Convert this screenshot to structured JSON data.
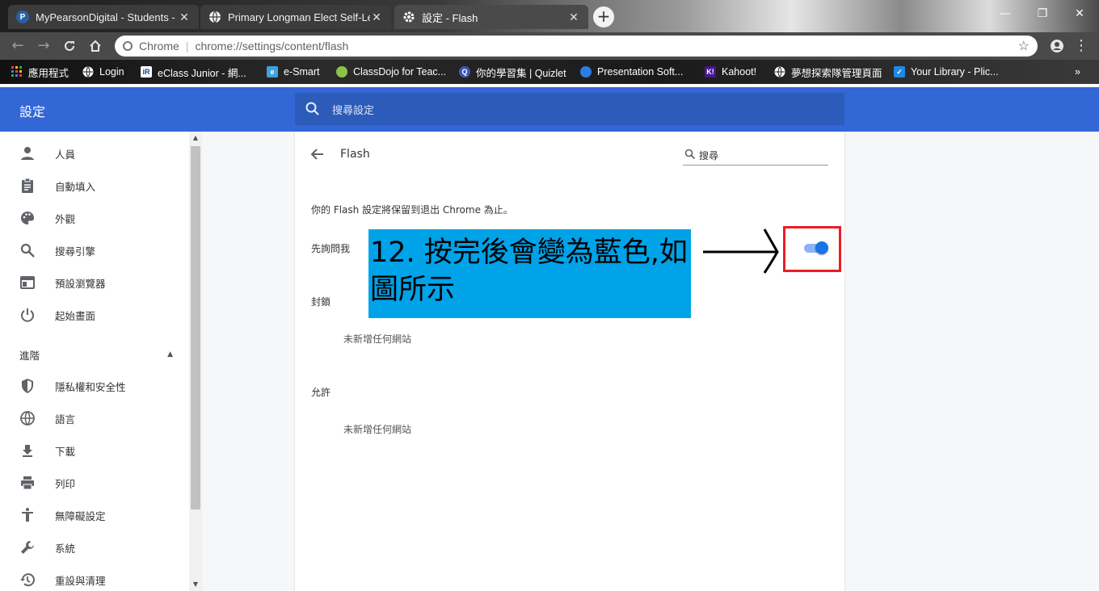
{
  "browser": {
    "tabs": [
      {
        "title": "MyPearsonDigital - Students - ",
        "favicon_color": "#2b5ea8",
        "favicon": "P",
        "active": false
      },
      {
        "title": "Primary Longman Elect Self-Lea",
        "favicon_color": "#5f6368",
        "favicon": "globe-icon",
        "active": false
      },
      {
        "title": "設定 - Flash",
        "favicon_color": "#5f6368",
        "favicon": "gear-icon",
        "active": true
      }
    ],
    "new_tab_label": "+",
    "window_controls": {
      "minimize": "—",
      "restore": "❐",
      "close": "✕"
    },
    "address": {
      "origin": "Chrome",
      "separator": "|",
      "url": "chrome://settings/content/flash"
    },
    "bookmarks": [
      {
        "label": "應用程式",
        "icon": "apps-grid-icon",
        "color": "#e8453c"
      },
      {
        "label": "Login",
        "icon": "globe-icon",
        "color": "#ffffff"
      },
      {
        "label": "eClass Junior - 網...",
        "icon": "eclass-icon",
        "color": "#ffffff"
      },
      {
        "label": "e-Smart",
        "icon": "esmart-icon",
        "color": "#3ea3dc"
      },
      {
        "label": "ClassDojo for Teac...",
        "icon": "classdojo-icon",
        "color": "#8bc34a"
      },
      {
        "label": "你的學習集 | Quizlet",
        "icon": "quizlet-icon",
        "color": "#4257b2"
      },
      {
        "label": "Presentation Soft...",
        "icon": "presentation-icon",
        "color": "#2d7de0"
      },
      {
        "label": "Kahoot!",
        "icon": "kahoot-icon",
        "color": "#46178f"
      },
      {
        "label": "夢想探索隊管理頁面",
        "icon": "globe-icon",
        "color": "#ffffff"
      },
      {
        "label": "Your Library - Plic...",
        "icon": "checkbox-icon",
        "color": "#1e88e5"
      }
    ],
    "more_bookmarks": "»"
  },
  "settings": {
    "title": "設定",
    "search_placeholder": "搜尋設定",
    "sidebar": {
      "items": [
        {
          "label": "人員",
          "icon": "person-icon"
        },
        {
          "label": "自動填入",
          "icon": "clipboard-icon"
        },
        {
          "label": "外觀",
          "icon": "palette-icon"
        },
        {
          "label": "搜尋引擎",
          "icon": "search-icon"
        },
        {
          "label": "預設瀏覽器",
          "icon": "browser-icon"
        },
        {
          "label": "起始畫面",
          "icon": "power-icon"
        }
      ],
      "advanced_label": "進階",
      "advanced_items": [
        {
          "label": "隱私權和安全性",
          "icon": "shield-icon"
        },
        {
          "label": "語言",
          "icon": "globe-icon"
        },
        {
          "label": "下載",
          "icon": "download-icon"
        },
        {
          "label": "列印",
          "icon": "printer-icon"
        },
        {
          "label": "無障礙設定",
          "icon": "accessibility-icon"
        },
        {
          "label": "系統",
          "icon": "wrench-icon"
        },
        {
          "label": "重設與清理",
          "icon": "history-icon"
        }
      ]
    },
    "page": {
      "title": "Flash",
      "search_placeholder": "搜尋",
      "description": "你的 Flash 設定將保留到退出 Chrome 為止。",
      "ask_first_label": "先詢問我",
      "ask_first_enabled": true,
      "block_label": "封鎖",
      "block_empty": "未新增任何網站",
      "allow_label": "允許",
      "allow_empty": "未新增任何網站"
    }
  },
  "annotation": {
    "text": "12. 按完後會變為藍色,如圖所示",
    "background": "#00a2e8",
    "highlight_color": "#ed1c24"
  }
}
